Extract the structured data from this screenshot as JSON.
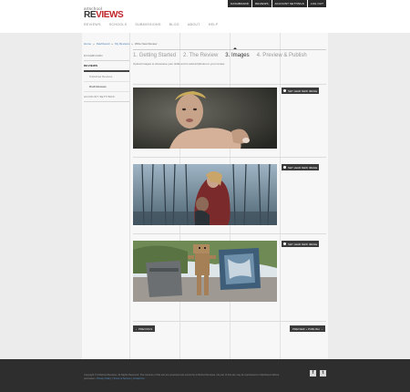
{
  "topbar": {
    "links": [
      "DASHBOARD",
      "REVIEWS",
      "ACCOUNT SETTINGS",
      "LOG OUT"
    ]
  },
  "logo": {
    "top": "artschool",
    "main_a": "RE",
    "main_b": "VIEWS"
  },
  "nav": {
    "items": [
      "REVIEWS",
      "SCHOOLS",
      "SUBMISSIONS",
      "BLOG",
      "ABOUT",
      "HELP"
    ]
  },
  "breadcrumb": {
    "items": [
      "Home",
      "Dashboard",
      "My Reviews"
    ],
    "sep": "»",
    "current": "Write New Review"
  },
  "sidebar": {
    "dashboard": "DASHBOARD",
    "reviews": "REVIEWS",
    "published": "Published Reviews",
    "draft": "Draft Reviews",
    "account": "ACCOUNT SETTINGS"
  },
  "steps": [
    "1. Getting Started",
    "2. The Review",
    "3. Images",
    "4. Preview & Publish"
  ],
  "intro": "Upload images to showcase your skills and to add art/photos to your review.",
  "add_image_label": "SET LEAD NEW IMAGE",
  "buttons": {
    "previous": "PREVIOUS",
    "next": "PREVIEW + PUBLISH"
  },
  "footer": {
    "text": "Copyright © ArtSchool Reviews. All Rights Reserved. The contents of this site are protected and owned by ArtSchool Reviews. No part of this site may be reproduced or distributed without permission.",
    "links": [
      "Privacy Policy",
      "Terms of Service",
      "Contact Us"
    ],
    "social": [
      "f",
      "t"
    ]
  },
  "colors": {
    "accent": "#c0252b",
    "dark": "#2e2e2e",
    "link": "#4a7fb3"
  }
}
